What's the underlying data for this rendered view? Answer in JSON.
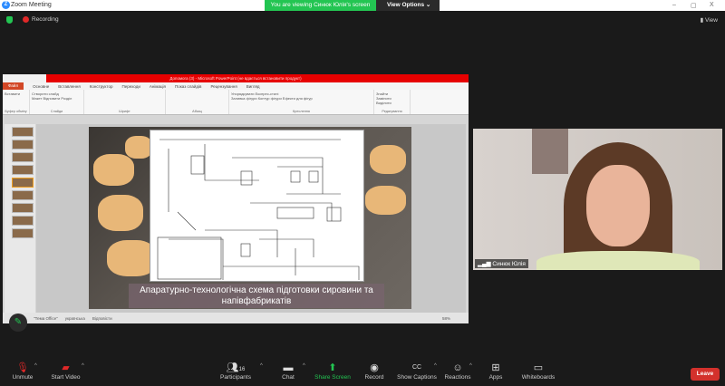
{
  "window": {
    "title": "Zoom Meeting",
    "banner": "You are viewing Синюк Юлія's screen",
    "view_options": "View Options",
    "minimize": "–",
    "maximize": "▢",
    "close": "X"
  },
  "topbar": {
    "recording": "Recording",
    "view": "View"
  },
  "ppt": {
    "title": "Допомога (3) - Microsoft PowerPoint (не вдається встановити продукт)",
    "tabs": [
      "Файл",
      "Основне",
      "Вставлення",
      "Конструктор",
      "Переходи",
      "Анімація",
      "Показ слайдів",
      "Рецензування",
      "Вигляд"
    ],
    "groups": [
      "Буфер обміну",
      "Слайди",
      "Шрифт",
      "Абзац",
      "Креслення",
      "Редагування"
    ],
    "ribbon_items": {
      "paste": "Вставити",
      "new_slide": "Створити слайд",
      "layout": "Макет",
      "reset": "Відновити",
      "section": "Розділ",
      "arrange": "Упорядкувати",
      "quick_styles": "Експрес-стилі",
      "fill": "Заливка фігури",
      "outline": "Контур фігури",
      "effects": "Ефекти для фігур",
      "find": "Знайти",
      "replace": "Замінити",
      "select": "Виділити"
    },
    "slide_caption": "Апаратурно-технологічна схема підготовки сировини та напівфабрикатів",
    "status": {
      "theme": "\"Тема Office\"",
      "language": "українська",
      "check": "Відповісти",
      "zoom": "58%"
    }
  },
  "participant": {
    "name": "Синюк Юлія"
  },
  "toolbar": {
    "unmute": "Unmute",
    "start_video": "Start Video",
    "participants": "Participants",
    "participants_count": "16",
    "chat": "Chat",
    "share": "Share Screen",
    "record": "Record",
    "captions": "Show Captions",
    "reactions": "Reactions",
    "apps": "Apps",
    "whiteboards": "Whiteboards",
    "leave": "Leave"
  },
  "colors": {
    "zoom_green": "#23c552",
    "leave": "#d3312c",
    "ppt_red": "#e60000"
  }
}
